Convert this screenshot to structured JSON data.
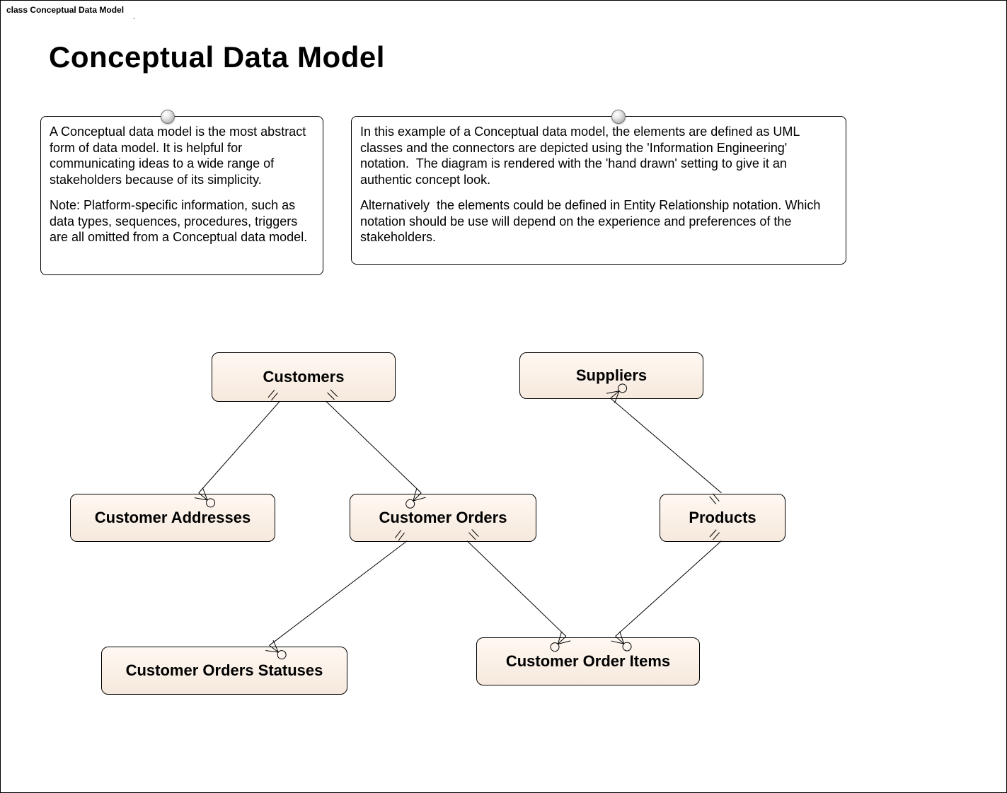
{
  "frame": {
    "tab_label": "class Conceptual Data Model"
  },
  "title": "Conceptual Data Model",
  "notes": {
    "left": {
      "p1": "A Conceptual data model is the most abstract form of data model. It is helpful for communicating ideas to a wide range of stakeholders because of its simplicity.",
      "p2": "Note: Platform-specific information, such as data types, sequences, procedures, triggers are all omitted from a Conceptual data model."
    },
    "right": {
      "p1": "In this example of a Conceptual data model, the elements are defined as UML classes and the connectors are depicted using the 'Information Engineering' notation.  The diagram is rendered with the 'hand drawn' setting to give it an authentic concept look.",
      "p2": "Alternatively  the elements could be defined in Entity Relationship notation. Which notation should be use will depend on the experience and preferences of the stakeholders."
    }
  },
  "entities": {
    "customers": "Customers",
    "suppliers": "Suppliers",
    "customer_addresses": "Customer Addresses",
    "customer_orders": "Customer Orders",
    "products": "Products",
    "customer_orders_statuses": "Customer Orders Statuses",
    "customer_order_items": "Customer Order Items"
  },
  "relationships": [
    {
      "from": "customers",
      "from_card": "one",
      "to": "customer_addresses",
      "to_card": "many"
    },
    {
      "from": "customers",
      "from_card": "one",
      "to": "customer_orders",
      "to_card": "many"
    },
    {
      "from": "suppliers",
      "from_card": "many",
      "to": "products",
      "to_card": "one"
    },
    {
      "from": "customer_orders",
      "from_card": "one",
      "to": "customer_orders_statuses",
      "to_card": "many"
    },
    {
      "from": "customer_orders",
      "from_card": "one",
      "to": "customer_order_items",
      "to_card": "many"
    },
    {
      "from": "products",
      "from_card": "one",
      "to": "customer_order_items",
      "to_card": "many"
    }
  ],
  "notation": "Information Engineering (crow's foot)"
}
